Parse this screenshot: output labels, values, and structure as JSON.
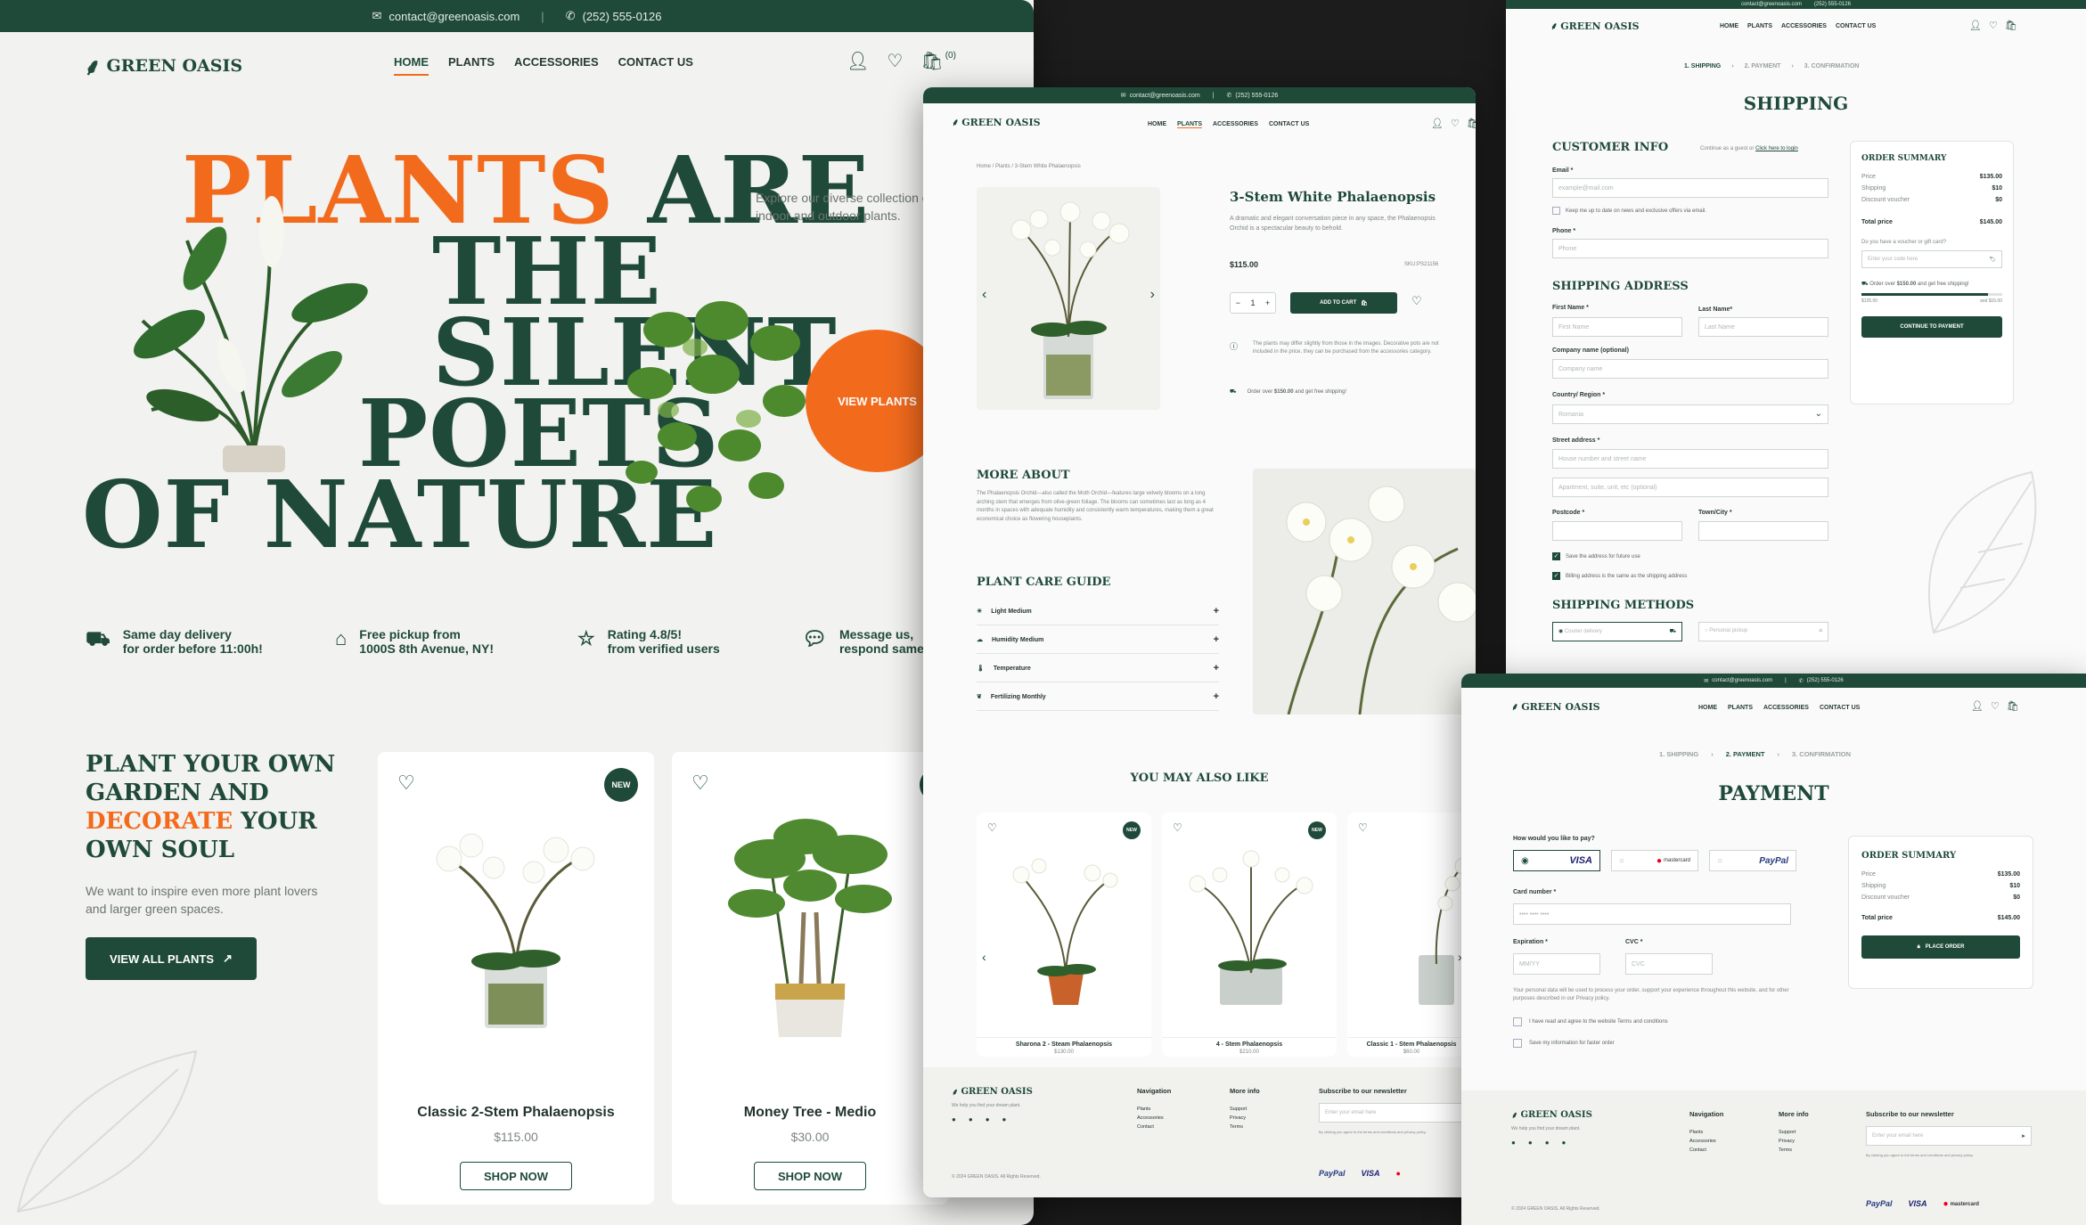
{
  "brand": {
    "name": "GREEN OASIS",
    "email": "contact@greenoasis.com",
    "phone": "(252) 555-0126"
  },
  "nav": [
    "HOME",
    "PLANTS",
    "ACCESSORIES",
    "CONTACT US"
  ],
  "cart_count": "(0)",
  "home": {
    "hero_word1": "PLANTS",
    "hero_word2": "ARE",
    "hero_line2": "THE SILENT",
    "hero_line3": "POETS",
    "hero_line4": "OF NATURE",
    "intro": "Explore our diverse collection of indoor and outdoor plants.",
    "view_plants": "VIEW PLANTS",
    "features": [
      {
        "l1": "Same day delivery",
        "l2": "for order before 11:00h!"
      },
      {
        "l1": "Free pickup from",
        "l2": "1000S 8th Avenue, NY!"
      },
      {
        "l1": "Rating 4.8/5!",
        "l2": "from verified users"
      },
      {
        "l1": "Message us,",
        "l2": "respond same"
      }
    ],
    "section_title_1": "PLANT YOUR OWN",
    "section_title_2": "GARDEN AND",
    "section_title_3a": "DECORATE",
    "section_title_3b": "YOUR",
    "section_title_4": "OWN SOUL",
    "section_text": "We want to inspire even more plant lovers and larger green spaces.",
    "view_all": "VIEW ALL PLANTS",
    "badge": "NEW",
    "products": [
      {
        "name": "Classic 2-Stem Phalaenopsis",
        "price": "$115.00",
        "cta": "SHOP NOW"
      },
      {
        "name": "Money Tree - Medio",
        "price": "$30.00",
        "cta": "SHOP NOW"
      }
    ]
  },
  "product": {
    "breadcrumb": "Home / Plants / 3-Stem White Phalaenopsis",
    "title": "3-Stem White Phalaenopsis",
    "desc": "A dramatic and elegant conversation piece in any space, the Phalaenopsis Orchid is a spectacular beauty to behold.",
    "price": "$115.00",
    "sku": "SKU:PS21156",
    "qty": "1",
    "add_to_cart": "ADD TO CART",
    "note": "The plants may differ slightly from those in the images. Decorative pots are not included in the price, they can be purchased from the accessories category.",
    "shipping_note_a": "Order over",
    "shipping_note_b": "$150.00",
    "shipping_note_c": "and get free shipping!",
    "more_about": "MORE ABOUT",
    "more_text": "The Phalaenopsis Orchid—also called the Moth Orchid—features large velvety blooms on a long arching stem that emerges from olive-green foliage. The blooms can sometimes last as long as 4 months in spaces with adequate humidity and consistently warm temperatures, making them a great economical choice as flowering houseplants.",
    "care_title": "PLANT CARE GUIDE",
    "care": [
      "Light Medium",
      "Humidity Medium",
      "Temperature",
      "Fertilizing Monthly"
    ],
    "also_like": "YOU MAY ALSO LIKE",
    "related": [
      {
        "name": "Sharona 2 - Steam Phalaenopsis",
        "price": "$130.00"
      },
      {
        "name": "4 - Stem Phalaenopsis",
        "price": "$210.00"
      },
      {
        "name": "Classic 1 - Stem Phalaenopsis",
        "price": "$60.00"
      }
    ],
    "footer_tag": "We help you find your dream plant.",
    "footer_nav_title": "Navigation",
    "footer_nav": [
      "Plants",
      "Accessories",
      "Contact"
    ],
    "footer_more_title": "More info",
    "footer_more": [
      "Support",
      "Privacy",
      "Terms"
    ],
    "newsletter": "Subscribe to our newsletter",
    "email_ph": "Enter your email here",
    "agree": "By clicking you agree to the terms and conditions and privacy policy.",
    "copyright": "© 2024 GREEN OASIS. All Rights Reserved."
  },
  "shipping": {
    "steps": [
      "1. SHIPPING",
      "2. PAYMENT",
      "3. CONFIRMATION"
    ],
    "title": "SHIPPING",
    "customer_info": "CUSTOMER INFO",
    "guest": "Continue as a guest",
    "or": "or",
    "login": "Click here to login",
    "email_label": "Email *",
    "email_ph": "example@mail.com",
    "newsletter_cb": "Keep me up to date on news and exclusive offers via email.",
    "phone_label": "Phone *",
    "phone_ph": "Phone",
    "address_title": "SHIPPING ADDRESS",
    "first_label": "First Name *",
    "first_ph": "First Name",
    "last_label": "Last Name*",
    "last_ph": "Last Name",
    "company_label": "Company name (optional)",
    "company_ph": "Company name",
    "country_label": "Country/ Region *",
    "country_value": "Romania",
    "street_label": "Street address *",
    "street_ph": "House number and street name",
    "apt_ph": "Apartment, suite, unit, etc (optional)",
    "postcode_label": "Postcode *",
    "town_label": "Town/City *",
    "save_cb": "Save the address for future use",
    "billing_cb": "Billing address is the same as the shipping address",
    "methods_title": "SHIPPING METHODS",
    "method1": "Courier delivery",
    "method2": "Personal pickup",
    "summary_title": "ORDER SUMMARY",
    "summary": [
      {
        "k": "Price",
        "v": "$135.00"
      },
      {
        "k": "Shipping",
        "v": "$10"
      },
      {
        "k": "Discount voucher",
        "v": "$0"
      }
    ],
    "total_k": "Total price",
    "total_v": "$145.00",
    "voucher_q": "Do you have a voucher or gift card?",
    "voucher_ph": "Enter your code here",
    "free_a": "Order over",
    "free_b": "$150.00",
    "free_c": "and get free shipping!",
    "progress": 0.9,
    "bar_min": "$135.00",
    "bar_max": "and $15.00",
    "continue": "CONTINUE TO PAYMENT"
  },
  "payment": {
    "steps": [
      "1. SHIPPING",
      "2. PAYMENT",
      "3. CONFIRMATION"
    ],
    "title": "PAYMENT",
    "question": "How would you like to pay?",
    "methods": [
      "VISA",
      "mastercard",
      "PayPal"
    ],
    "card_label": "Card number *",
    "card_ph": "•••• •••• ••••",
    "exp_label": "Expiration *",
    "exp_ph": "MM/YY",
    "cvc_label": "CVC *",
    "cvc_ph": "CVC",
    "privacy": "Your personal data will be used to process your order, support your experience throughout this website, and for other purposes described in our Privacy policy.",
    "terms_cb": "I have read and agree to the website Terms and conditions",
    "save_cb": "Save my information for faster order",
    "summary_title": "ORDER SUMMARY",
    "summary": [
      {
        "k": "Price",
        "v": "$135.00"
      },
      {
        "k": "Shipping",
        "v": "$10"
      },
      {
        "k": "Discount voucher",
        "v": "$0"
      }
    ],
    "total_k": "Total price",
    "total_v": "$145.00",
    "place_order": "PLACE ORDER",
    "pay_logos": [
      "PayPal",
      "VISA",
      "mastercard"
    ]
  }
}
